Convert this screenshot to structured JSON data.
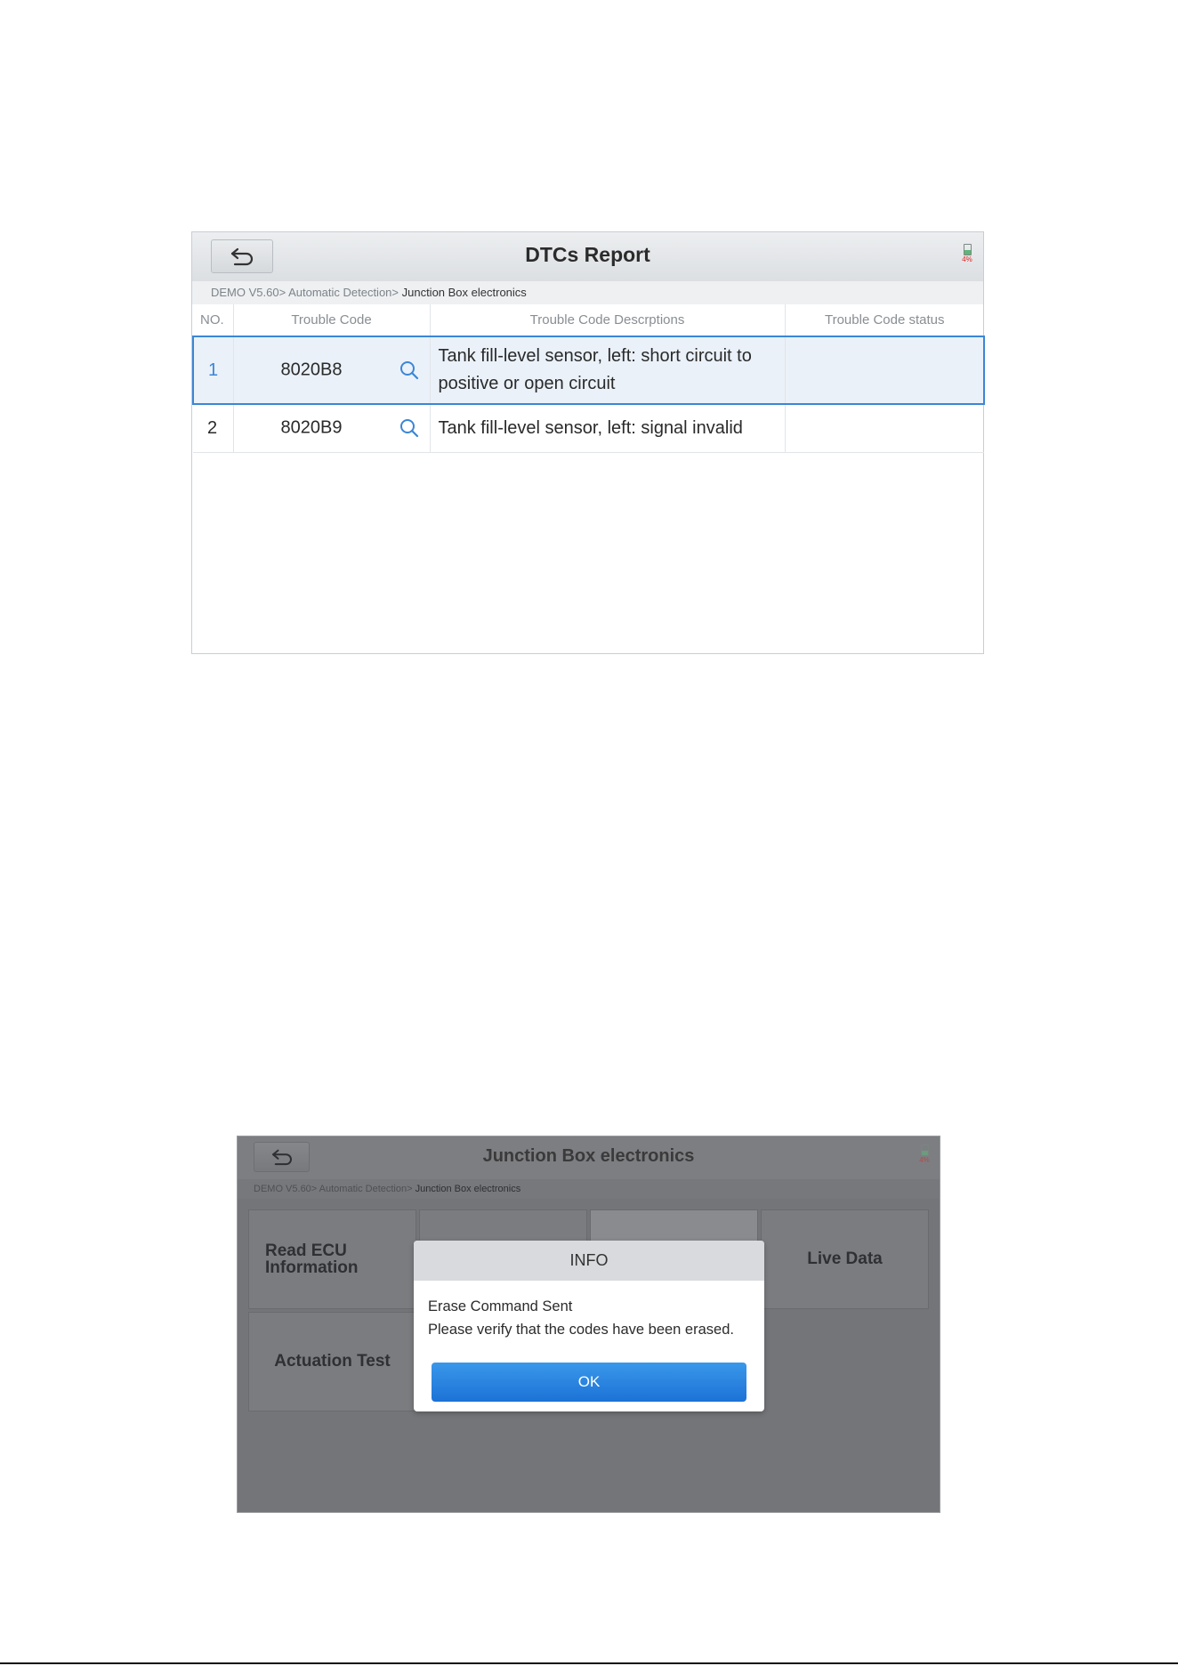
{
  "dtc_screen": {
    "title": "DTCs Report",
    "battery_pct": "4%",
    "breadcrumb": {
      "path": "DEMO V5.60> Automatic Detection> ",
      "current": "Junction Box electronics"
    },
    "columns": [
      "NO.",
      "Trouble Code",
      "Trouble Code Descrptions",
      "Trouble Code status"
    ],
    "rows": [
      {
        "no": "1",
        "code": "8020B8",
        "description": "Tank fill-level sensor, left: short circuit to positive or open circuit",
        "status": "",
        "selected": true
      },
      {
        "no": "2",
        "code": "8020B9",
        "description": "Tank fill-level sensor, left: signal invalid",
        "status": "",
        "selected": false
      }
    ],
    "accent_color": "#3a86d8"
  },
  "menu_screen": {
    "title": "Junction Box electronics",
    "battery_pct": "4%",
    "breadcrumb": {
      "path": "DEMO V5.60> Automatic Detection> ",
      "current": "Junction Box electronics"
    },
    "tiles": {
      "read_ecu": "Read ECU Information",
      "live_data": "Live Data",
      "actuation_test": "Actuation Test"
    },
    "dialog": {
      "title": "INFO",
      "line1": "Erase Command Sent",
      "line2": "Please verify that the codes have been erased.",
      "ok_label": "OK",
      "button_color": "#1c72d6"
    }
  }
}
